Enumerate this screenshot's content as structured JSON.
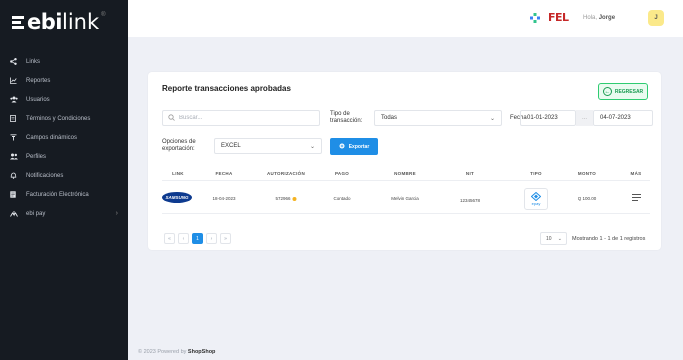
{
  "brand": {
    "logo_bold": "ebi",
    "logo_light": "link"
  },
  "sidebar": {
    "items": [
      {
        "label": "Links",
        "icon": "share-icon"
      },
      {
        "label": "Reportes",
        "icon": "chart-icon"
      },
      {
        "label": "Usuarios",
        "icon": "users-icon"
      },
      {
        "label": "Términos y Condiciones",
        "icon": "document-icon"
      },
      {
        "label": "Campos dinámicos",
        "icon": "filter-icon"
      },
      {
        "label": "Perfiles",
        "icon": "profiles-icon"
      },
      {
        "label": "Notificaciones",
        "icon": "bell-icon"
      },
      {
        "label": "Facturación Electrónica",
        "icon": "invoice-icon"
      },
      {
        "label": "ebi pay",
        "icon": "pay-icon"
      }
    ]
  },
  "topbar": {
    "fel_label": "FEL",
    "greeting_prefix": "Hola,",
    "user_name": "Jorge",
    "avatar_initial": "J"
  },
  "report": {
    "title": "Reporte transacciones aprobadas",
    "back_label": "REGRESAR",
    "search_placeholder": "Buscar...",
    "type_label_1": "Tipo de",
    "type_label_2": "transacción:",
    "type_value": "Todas",
    "date_label": "Fecha",
    "date_from": "01-01-2023",
    "date_sep": "...",
    "date_to": "04-07-2023",
    "export_label_1": "Opciones de",
    "export_label_2": "exportación:",
    "export_value": "EXCEL",
    "export_button": "Exportar"
  },
  "table": {
    "columns": [
      "LINK",
      "FECHA",
      "AUTORIZACIÓN",
      "PAGO",
      "NOMBRE",
      "NIT",
      "TIPO",
      "MONTO",
      "MÁS"
    ],
    "rows": [
      {
        "link_brand": "SAMSUNG",
        "fecha": "18-04-2023",
        "autorizacion": "572966",
        "pago": "Contado",
        "nombre": "Melvin Garcia",
        "nit": "12345678",
        "tipo": "epay",
        "monto": "Q 100.00"
      }
    ]
  },
  "pagination": {
    "buttons": [
      "«",
      "‹",
      "1",
      "›",
      "»"
    ],
    "active_index": 2,
    "page_size": "10",
    "range_text": "Mostrando 1 - 1 de 1 registros"
  },
  "footer": {
    "prefix": "© 2023 Powered by",
    "brand": "ShopShop"
  },
  "colors": {
    "sidebar_bg": "#161b22",
    "primary": "#1f8ee6",
    "success": "#2ecc71",
    "page_bg": "#eef0f6"
  }
}
